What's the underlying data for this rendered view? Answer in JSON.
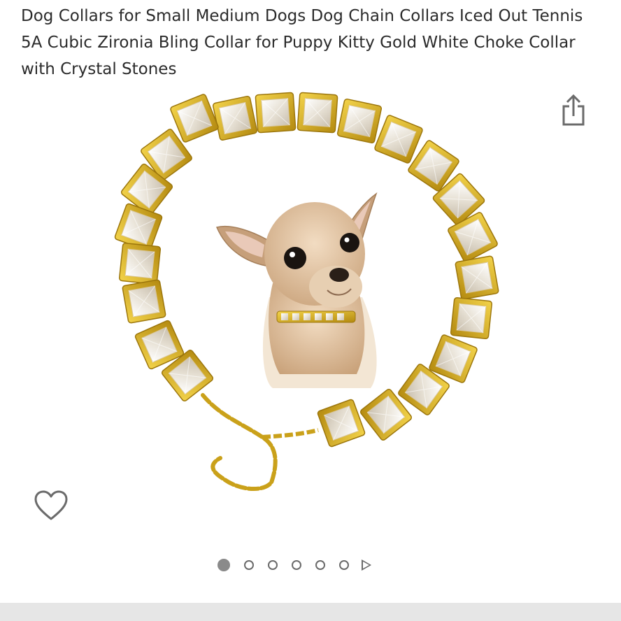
{
  "product": {
    "title": "Dog Collars for Small Medium Dogs Dog Chain Collars Iced Out Tennis 5A Cubic Zironia Bling Collar for Puppy Kitty Gold White Choke Collar with Crystal Stones"
  },
  "icons": {
    "share": "share-icon",
    "wishlist": "heart-outline-icon",
    "next": "play-triangle-icon"
  },
  "carousel": {
    "total_images": 6,
    "active_index": 0
  },
  "colors": {
    "gold": "#d9b21f",
    "gold_dark": "#b48a10",
    "title_text": "#2b2b2b",
    "icon_gray": "#6b6b6b"
  }
}
